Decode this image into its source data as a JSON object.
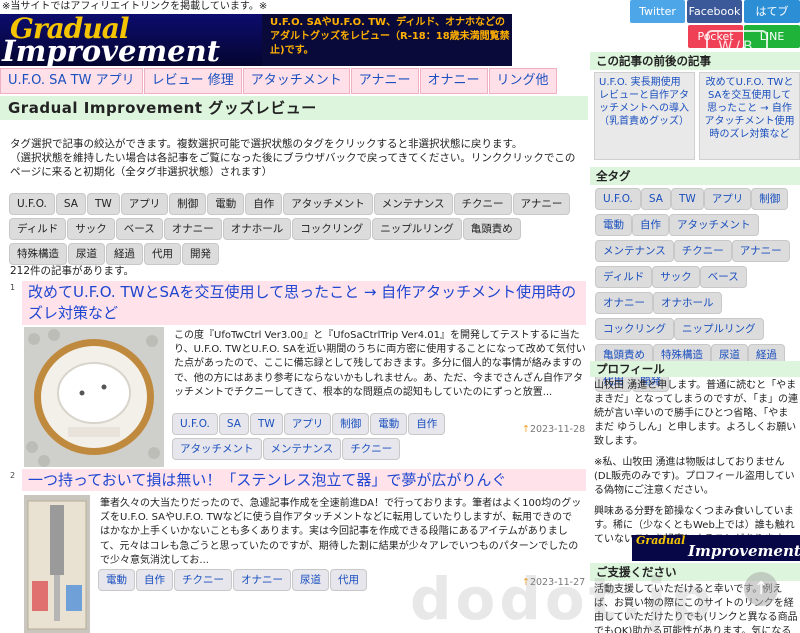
{
  "top_note": "※当サイトではアフィリエイトリンクを掲載しています。※",
  "header": {
    "logo_line1": "Gradual",
    "logo_line2": "Improvement",
    "description": "U.F.O. SAやU.F.O. TW、ディルド、オナホなどのアダルトグッズをレビュー（R-18：18歳未満閲覧禁止)です。"
  },
  "social": {
    "twitter": "Twitter",
    "facebook": "Facebook",
    "hatena": "はてブ",
    "pocket": "Pocket",
    "line": "LINE",
    "wb_badge": "W/B"
  },
  "nav": [
    "U.F.O. SA TW アプリ",
    "レビュー 修理",
    "アタッチメント",
    "アナニー",
    "オナニー",
    "リング他"
  ],
  "page_title": "Gradual Improvement グッズレビュー",
  "intro": {
    "line1": "タグ選択で記事の絞込ができます。複数選択可能で選択状態のタグをクリックすると非選択状態に戻ります。",
    "line2": "（選択状態を維持したい場合は各記事をご覧になった後にブラウザバックで戻ってきてください。リンククリックでこのページに来ると初期化（全タグ非選択状態）されます）"
  },
  "tags": [
    "U.F.O.",
    "SA",
    "TW",
    "アプリ",
    "制御",
    "電動",
    "自作",
    "アタッチメント",
    "メンテナンス",
    "チクニー",
    "アナニー",
    "ディルド",
    "サック",
    "ベース",
    "オナニー",
    "オナホール",
    "コックリング",
    "ニップルリング",
    "亀頭責め",
    "特殊構造",
    "尿道",
    "経過",
    "代用",
    "開発"
  ],
  "article_count": "212件の記事があります。",
  "articles": [
    {
      "num": "1",
      "title": "改めてU.F.O. TWとSAを交互使用して思ったこと → 自作アタッチメント使用時のズレ対策など",
      "excerpt": "この度『UfoTwCtrl Ver3.00』と『UfoSaCtrlTrip Ver4.01』を開発してテストするに当たり、U.F.O. TWとU.F.O. SAを近い期間のうちに両方密に使用することになって改めて気付いた点があったので、ここに備忘録として残しておきます。多分に個人的な事情が絡みますので、他の方にはあまり参考にならないかもしれません。あ、ただ、今までさんざん自作アタッチメントでチクニーしてきて、根本的な問題点の認知もしていたのにずっと放置...",
      "tags": [
        "U.F.O.",
        "SA",
        "TW",
        "アプリ",
        "制御",
        "電動",
        "自作",
        "アタッチメント",
        "メンテナンス",
        "チクニー"
      ],
      "date": "2023-11-28"
    },
    {
      "num": "2",
      "title": "一つ持っておいて損は無い！「ステンレス泡立て器」で夢が広がりんぐ",
      "excerpt": "筆者久々の大当たりだったので、急遽記事作成を全速前進DA！で行っております。筆者はよく100均のグッズをU.F.O. SAやU.F.O. TWなどに使う自作アタッチメントなどに転用していたりしますが、転用できのではかなか上手くいかないことも多くあります。実は今回記事を作成できる段階にあるアイテムがありまして、元々はコレも急ごうと思っていたのですが、期待した割に結果が少々アレでいつものパターンでしたので少々意気消沈してお...",
      "tags": [
        "電動",
        "自作",
        "チクニー",
        "オナニー",
        "尿道",
        "代用"
      ],
      "date": "2023-11-27"
    }
  ],
  "sidebar": {
    "related_heading": "この記事の前後の記事",
    "related_prev": "U.F.O. 実長期使用レビューと自作アタッチメントへの導入 （乳首責めグッズ）",
    "related_next": "改めてU.F.O. TWとSAを交互使用して思ったこと → 自作アタッチメント使用時のズレ対策など",
    "alltags_heading": "全タグ",
    "profile_heading": "プロフィール",
    "profile_p1": "山牧田 湧進と申します。普通に読むと「やままきだ」となってしまうのですが、「ま」の連続が言い辛いので勝手にひとつ省略、「やままだ ゆうしん」と申します。よろしくお願い致します。",
    "profile_p2": "※私、山牧田 湧進は物販はしておりません(DL販売のみです)。プロフィール盗用している偽物にご注意ください。",
    "profile_p3": "興味ある分野を節操なくつまみ食いしています。稀に（少なくともWeb上では）誰も触れていないことを記事にすることがあります。",
    "mini_logo1": "Gradual",
    "mini_logo2": "Improvement",
    "support_heading": "ご支援ください",
    "support_text": "活動支援していただけると幸いです。例えば、お買い物の際にこのサイトのリンクを経由していただけたりでも(リンクと異なる商品でもOK)助かる可能性があります。気になる"
  },
  "watermark": "dodot.jp"
}
